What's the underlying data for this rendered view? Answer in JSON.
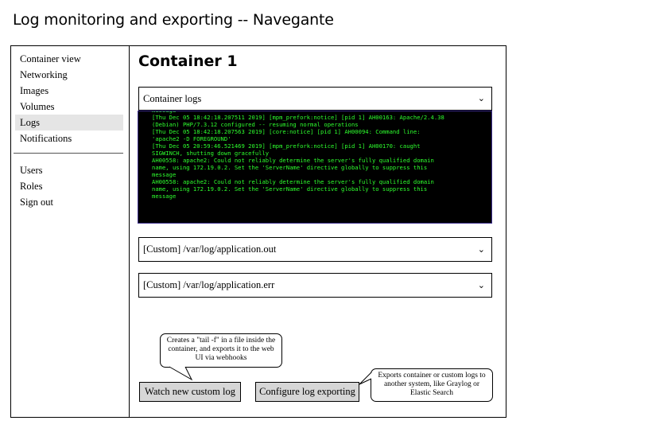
{
  "page_title": "Log monitoring and exporting -- Navegante",
  "sidebar": {
    "items": [
      {
        "label": "Container view"
      },
      {
        "label": "Networking"
      },
      {
        "label": "Images"
      },
      {
        "label": "Volumes"
      },
      {
        "label": "Logs",
        "active": true
      },
      {
        "label": "Notifications"
      }
    ],
    "secondary_items": [
      {
        "label": "Users"
      },
      {
        "label": "Roles"
      },
      {
        "label": "Sign out"
      }
    ]
  },
  "main": {
    "title": "Container 1",
    "log_panels": [
      {
        "label": "Container logs",
        "expanded": true
      },
      {
        "label": "[Custom] /var/log/application.out",
        "expanded": false
      },
      {
        "label": "[Custom] /var/log/application.err",
        "expanded": false
      }
    ],
    "console_lines": [
      "message",
      "[Thu Dec 05 18:42:18.207511 2019] [mpm_prefork:notice] [pid 1] AH00163: Apache/2.4.38",
      "(Debian) PHP/7.3.12 configured -- resuming normal operations",
      "[Thu Dec 05 18:42:18.207563 2019] [core:notice] [pid 1] AH00094: Command line:",
      "'apache2 -D FOREGROUND'",
      "[Thu Dec 05 20:59:46.521469 2019] [mpm_prefork:notice] [pid 1] AH00170: caught",
      "SIGWINCH, shutting down gracefully",
      "AH00558: apache2: Could not reliably determine the server's fully qualified domain",
      "name, using 172.19.0.2. Set the 'ServerName' directive globally to suppress this",
      "message",
      "AH00558: apache2: Could not reliably determine the server's fully qualified domain",
      "name, using 172.19.0.2. Set the 'ServerName' directive globally to suppress this",
      "message"
    ],
    "buttons": {
      "watch_label": "Watch new custom log",
      "configure_label": "Configure log exporting"
    },
    "notes": {
      "watch_note": "Creates a \"tail -f\" in a file inside the container, and exports it to the web UI via webhooks",
      "configure_note": "Exports container or custom logs to another system, like Graylog or Elastic Search"
    }
  },
  "colors": {
    "console_background": "#000000",
    "console_text": "#2eff2e",
    "active_nav": "#e5e5e5",
    "button_fill": "#d6d6d6"
  },
  "icons": {
    "dropdown": "chevron-down-icon"
  }
}
